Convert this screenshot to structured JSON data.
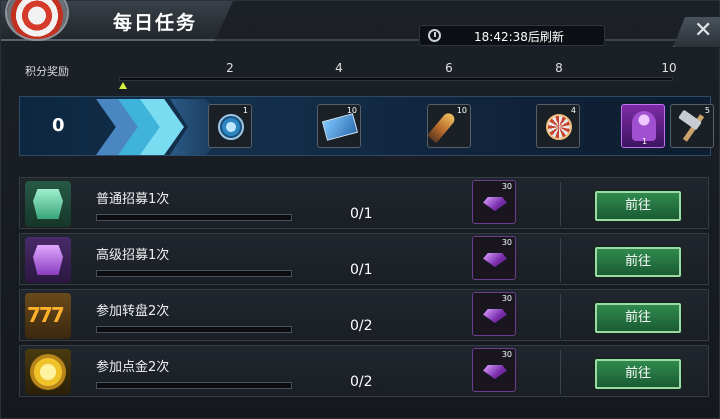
{
  "window": {
    "title": "每日任务",
    "refresh_text": "18:42:38后刷新",
    "close_label": "✕"
  },
  "points": {
    "label": "积分奖励",
    "current": "0",
    "ticks": [
      "2",
      "4",
      "6",
      "8",
      "10"
    ],
    "progress_fraction": 0.0
  },
  "rewards": [
    {
      "icon": "coin-icon",
      "count": "1"
    },
    {
      "icon": "ticket-icon",
      "count": "10"
    },
    {
      "icon": "shell-icon",
      "count": "10"
    },
    {
      "icon": "wheel-icon",
      "count": "4"
    },
    {
      "icon": "purple-hero-icon",
      "count": "1"
    },
    {
      "icon": "hammer-icon",
      "count": "5"
    }
  ],
  "tasks": [
    {
      "name": "普通招募1次",
      "progress": "0/1",
      "fraction": 0.0,
      "reward_icon": "purple-gem-icon",
      "reward_count": "30",
      "button": "前往",
      "icon": "green-chest-icon"
    },
    {
      "name": "高级招募1次",
      "progress": "0/1",
      "fraction": 0.0,
      "reward_icon": "purple-gem-icon",
      "reward_count": "30",
      "button": "前往",
      "icon": "purple-chest-icon"
    },
    {
      "name": "参加转盘2次",
      "progress": "0/2",
      "fraction": 0.0,
      "reward_icon": "purple-gem-icon",
      "reward_count": "30",
      "button": "前往",
      "icon": "slot-777-icon"
    },
    {
      "name": "参加点金2次",
      "progress": "0/2",
      "fraction": 0.0,
      "reward_icon": "purple-gem-icon",
      "reward_count": "30",
      "button": "前往",
      "icon": "gold-coin-icon"
    }
  ]
}
